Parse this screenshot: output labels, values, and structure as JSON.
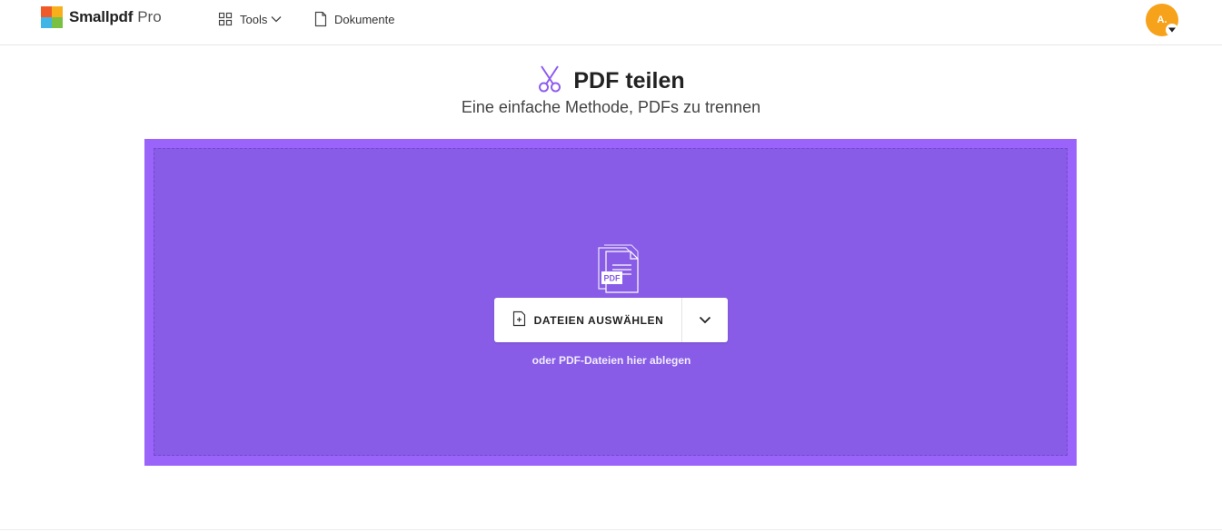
{
  "brand": {
    "name": "Smallpdf",
    "tier": "Pro",
    "logo_colors": [
      "#f05a28",
      "#f7b01c",
      "#41b6e6",
      "#7ac143",
      "#a25cf4"
    ]
  },
  "nav": {
    "tools_label": "Tools",
    "documents_label": "Dokumente"
  },
  "user": {
    "initials": "A.",
    "avatar_color": "#f7a21b"
  },
  "tool": {
    "title": "PDF teilen",
    "subtitle": "Eine einfache Methode, PDFs zu trennen",
    "icon": "scissors-icon",
    "accent_color": "#9a63fa"
  },
  "dropzone": {
    "choose_label": "DATEIEN AUSWÄHLEN",
    "hint": "oder PDF-Dateien hier ablegen",
    "file_badge": "PDF",
    "background": "#885ce6"
  }
}
